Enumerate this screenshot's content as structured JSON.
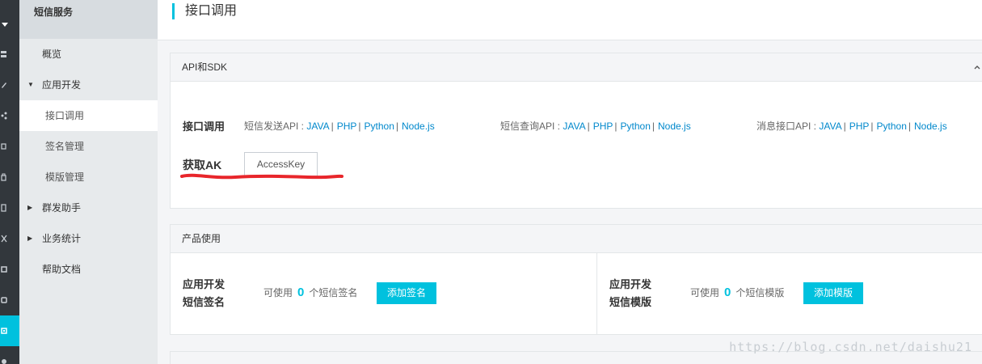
{
  "sidebar": {
    "title": "短信服务",
    "items": [
      {
        "label": "概览"
      },
      {
        "label": "应用开发"
      },
      {
        "label": "接口调用"
      },
      {
        "label": "签名管理"
      },
      {
        "label": "模版管理"
      },
      {
        "label": "群发助手"
      },
      {
        "label": "业务统计"
      },
      {
        "label": "帮助文档"
      }
    ]
  },
  "page": {
    "title": "接口调用"
  },
  "api_panel": {
    "header": "API和SDK",
    "collapse_icon": "chevron-up-icon",
    "row_label": "接口调用",
    "groups": [
      {
        "label": "短信发送API :",
        "links": [
          "JAVA",
          "PHP",
          "Python",
          "Node.js"
        ]
      },
      {
        "label": "短信查询API :",
        "links": [
          "JAVA",
          "PHP",
          "Python",
          "Node.js"
        ]
      },
      {
        "label": "消息接口API :",
        "links": [
          "JAVA",
          "PHP",
          "Python",
          "Node.js"
        ]
      }
    ],
    "separator": "|",
    "ak_label": "获取AK",
    "ak_button": "AccessKey",
    "annotation_color": "#e8262b"
  },
  "product_panel": {
    "header": "产品使用",
    "cells": [
      {
        "title_line1": "应用开发",
        "title_line2": "短信签名",
        "prefix": "可使用",
        "count": "0",
        "suffix": "个短信签名",
        "button": "添加签名"
      },
      {
        "title_line1": "应用开发",
        "title_line2": "短信模版",
        "prefix": "可使用",
        "count": "0",
        "suffix": "个短信模版",
        "button": "添加模版"
      }
    ]
  },
  "third_panel": {
    "header": ""
  },
  "watermark": "https://blog.csdn.net/daishu21",
  "colors": {
    "accent": "#00c1de",
    "link": "#0088cc",
    "rail": "#32373c"
  }
}
